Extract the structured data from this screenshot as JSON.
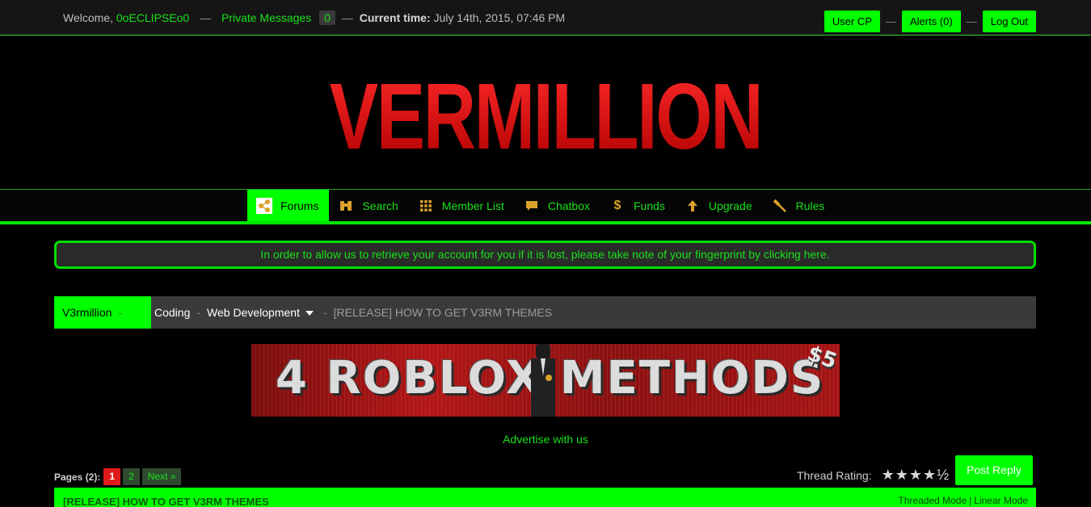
{
  "topbar": {
    "welcome_label": "Welcome,",
    "username": "0oECLIPSEo0",
    "private_messages_label": "Private Messages",
    "pm_count": "0",
    "time_label": "Current time:",
    "time_value": "July 14th, 2015, 07:46 PM",
    "user_cp": "User CP",
    "alerts": "Alerts (0)",
    "logout": "Log Out"
  },
  "header": {
    "logo_text": "VERMILLION"
  },
  "nav": {
    "items": [
      {
        "label": "Forums",
        "icon": "forums-icon",
        "active": true
      },
      {
        "label": "Search",
        "icon": "binoculars-icon"
      },
      {
        "label": "Member List",
        "icon": "grid-icon"
      },
      {
        "label": "Chatbox",
        "icon": "chat-bubble-icon"
      },
      {
        "label": "Funds",
        "icon": "dollar-icon"
      },
      {
        "label": "Upgrade",
        "icon": "up-arrow-icon"
      },
      {
        "label": "Rules",
        "icon": "gavel-icon"
      }
    ]
  },
  "notice": {
    "text": "In order to allow us to retrieve your account for you if it is lost, please take note of your fingerprint by clicking here."
  },
  "breadcrumb": {
    "home": "V3rmillion",
    "items": [
      "Coding",
      "Web Development"
    ],
    "current": "[RELEASE] HOW TO GET V3RM THEMES"
  },
  "banner": {
    "text": "4 ROBLOX METHODS",
    "price": "$5"
  },
  "advertise": "Advertise with us",
  "pagination": {
    "label": "Pages (2):",
    "current": "1",
    "pages": [
      "2"
    ],
    "next": "Next »"
  },
  "rating": {
    "label": "Thread Rating:",
    "stars": "★★★★½",
    "value": 4.5,
    "max": 5
  },
  "post_reply": "Post Reply",
  "thread": {
    "title": "[RELEASE] HOW TO GET V3RM THEMES",
    "threaded_mode": "Threaded Mode",
    "linear_mode": "Linear Mode"
  },
  "colors": {
    "accent": "#00ff00",
    "logo_red": "#d80d0d",
    "background": "#000000"
  }
}
